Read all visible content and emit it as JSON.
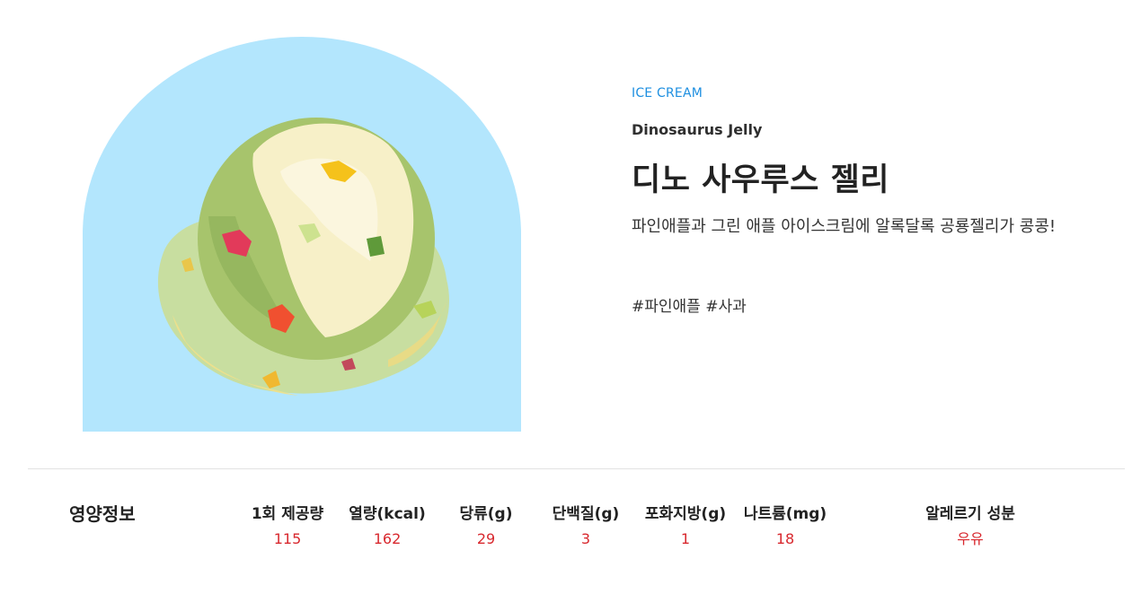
{
  "product": {
    "category": "ICE CREAM",
    "name_en": "Dinosaurus Jelly",
    "name_ko": "디노 사우루스 젤리",
    "description": "파인애플과 그린 애플 아이스크림에 알록달록 공룡젤리가 콩콩!",
    "tags": "#파인애플 #사과",
    "image_icon": "ice-cream-scoop"
  },
  "nutrition": {
    "title": "영양정보",
    "columns": [
      {
        "label": "1회 제공량",
        "value": "115"
      },
      {
        "label": "열량(kcal)",
        "value": "162"
      },
      {
        "label": "당류(g)",
        "value": "29"
      },
      {
        "label": "단백질(g)",
        "value": "3"
      },
      {
        "label": "포화지방(g)",
        "value": "1"
      },
      {
        "label": "나트륨(mg)",
        "value": "18"
      }
    ],
    "allergy": {
      "label": "알레르기 성분",
      "value": "우유"
    }
  },
  "colors": {
    "accent": "#1e8fe0",
    "value": "#d8282e",
    "arch": "#b3e6fd"
  }
}
